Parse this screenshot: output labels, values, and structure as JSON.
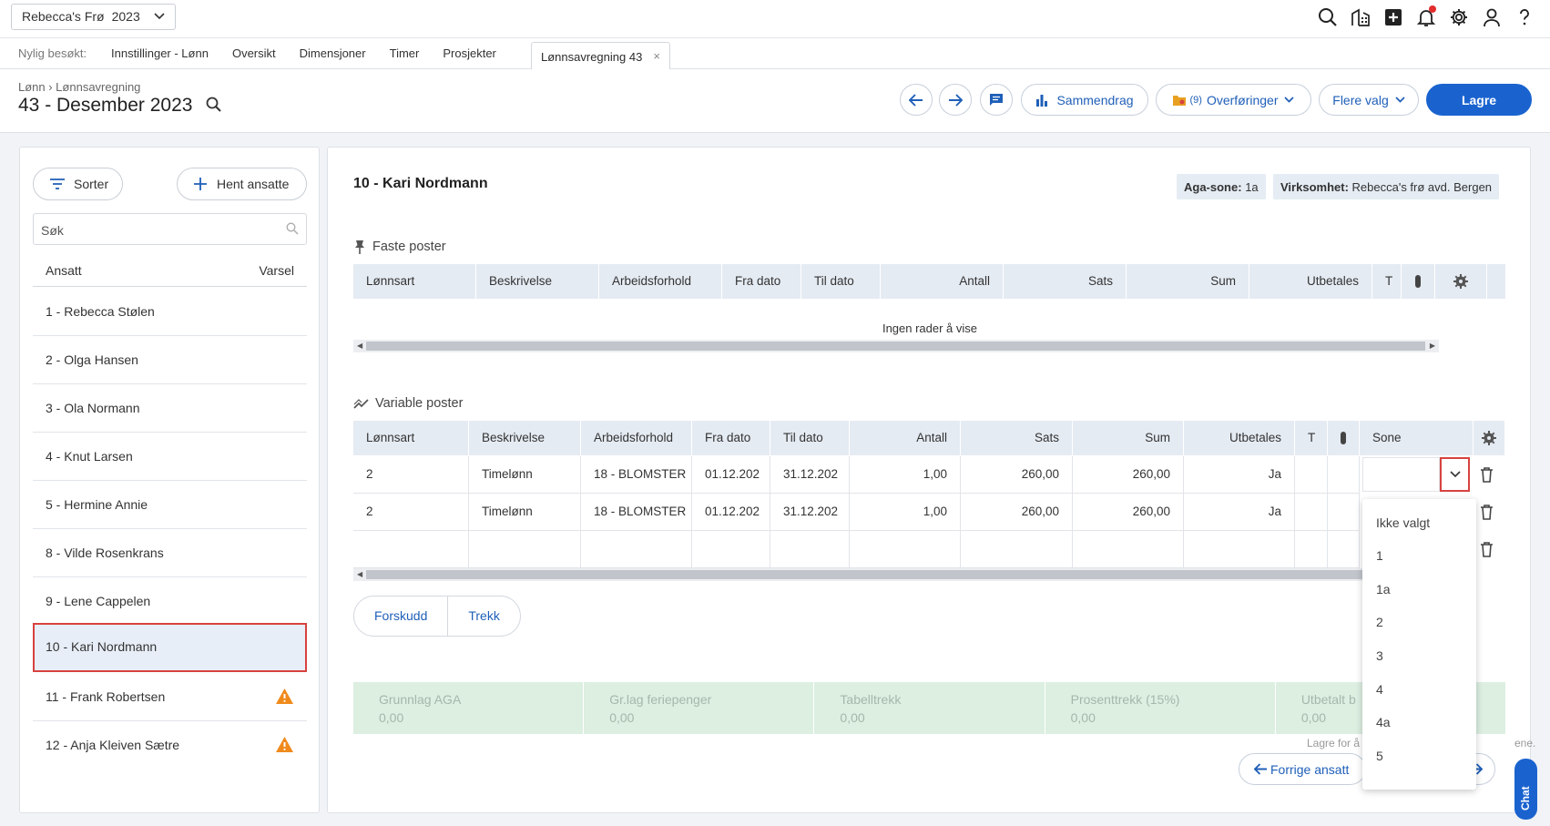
{
  "topbar": {
    "company": "Rebecca's Frø",
    "year": "2023",
    "icons": [
      "search-icon",
      "buildings-icon",
      "plus-square-icon",
      "bell-icon",
      "gear-icon",
      "user-icon",
      "help-icon"
    ]
  },
  "recent": {
    "label": "Nylig besøkt:",
    "links": [
      "Innstillinger - Lønn",
      "Oversikt",
      "Dimensjoner",
      "Timer",
      "Prosjekter"
    ],
    "open_tab": "Lønnsavregning 43"
  },
  "header": {
    "breadcrumb": "Lønn › Lønnsavregning",
    "title": "43 - Desember 2023",
    "buttons": {
      "summary": "Sammendrag",
      "transfers_count": "(9)",
      "transfers": "Overføringer",
      "more": "Flere valg",
      "save": "Lagre"
    }
  },
  "left": {
    "sort": "Sorter",
    "fetch": "Hent ansatte",
    "search_placeholder": "Søk",
    "col_employee": "Ansatt",
    "col_alert": "Varsel",
    "employees": [
      {
        "name": "1 - Rebecca Stølen",
        "warn": false
      },
      {
        "name": "2 - Olga Hansen",
        "warn": false
      },
      {
        "name": "3 - Ola Normann",
        "warn": false
      },
      {
        "name": "4 - Knut Larsen",
        "warn": false
      },
      {
        "name": "5 - Hermine Annie",
        "warn": false
      },
      {
        "name": "8 - Vilde Rosenkrans",
        "warn": false
      },
      {
        "name": "9 - Lene Cappelen",
        "warn": false
      },
      {
        "name": "10 - Kari Nordmann",
        "warn": false,
        "selected": true
      },
      {
        "name": "11 - Frank Robertsen",
        "warn": true
      },
      {
        "name": "12 - Anja Kleiven Sætre",
        "warn": true
      }
    ]
  },
  "main": {
    "employee_title": "10 - Kari Nordmann",
    "aga_label": "Aga-sone:",
    "aga_value": "1a",
    "business_label": "Virksomhet:",
    "business_value": "Rebecca's frø avd. Bergen",
    "fixed": {
      "title": "Faste poster",
      "columns": [
        "Lønnsart",
        "Beskrivelse",
        "Arbeidsforhold",
        "Fra dato",
        "Til dato",
        "Antall",
        "Sats",
        "Sum",
        "Utbetales",
        "T"
      ],
      "empty": "Ingen rader å vise"
    },
    "variable": {
      "title": "Variable poster",
      "columns": [
        "Lønnsart",
        "Beskrivelse",
        "Arbeidsforhold",
        "Fra dato",
        "Til dato",
        "Antall",
        "Sats",
        "Sum",
        "Utbetales",
        "T",
        "Sone"
      ],
      "rows": [
        {
          "type": "2",
          "desc": "Timelønn",
          "employment": "18 - BLOMSTER",
          "from": "01.12.202",
          "to": "31.12.202",
          "qty": "1,00",
          "rate": "260,00",
          "sum": "260,00",
          "paid": "Ja"
        },
        {
          "type": "2",
          "desc": "Timelønn",
          "employment": "18 - BLOMSTER",
          "from": "01.12.202",
          "to": "31.12.202",
          "qty": "1,00",
          "rate": "260,00",
          "sum": "260,00",
          "paid": "Ja"
        }
      ]
    },
    "tabs": [
      "Forskudd",
      "Trekk"
    ],
    "summary": [
      {
        "label": "Grunnlag AGA",
        "value": "0,00"
      },
      {
        "label": "Gr.lag feriepenger",
        "value": "0,00"
      },
      {
        "label": "Tabelltrekk",
        "value": "0,00"
      },
      {
        "label": "Prosenttrekk (15%)",
        "value": "0,00"
      },
      {
        "label": "Utbetalt b",
        "value": "0,00"
      }
    ],
    "note_left": "Lagre for å",
    "note_right": "ene.",
    "prev_employee": "Forrige ansatt"
  },
  "zone_dropdown": {
    "options": [
      "Ikke valgt",
      "1",
      "1a",
      "2",
      "3",
      "4",
      "4a",
      "5"
    ]
  },
  "chat": "Chat"
}
